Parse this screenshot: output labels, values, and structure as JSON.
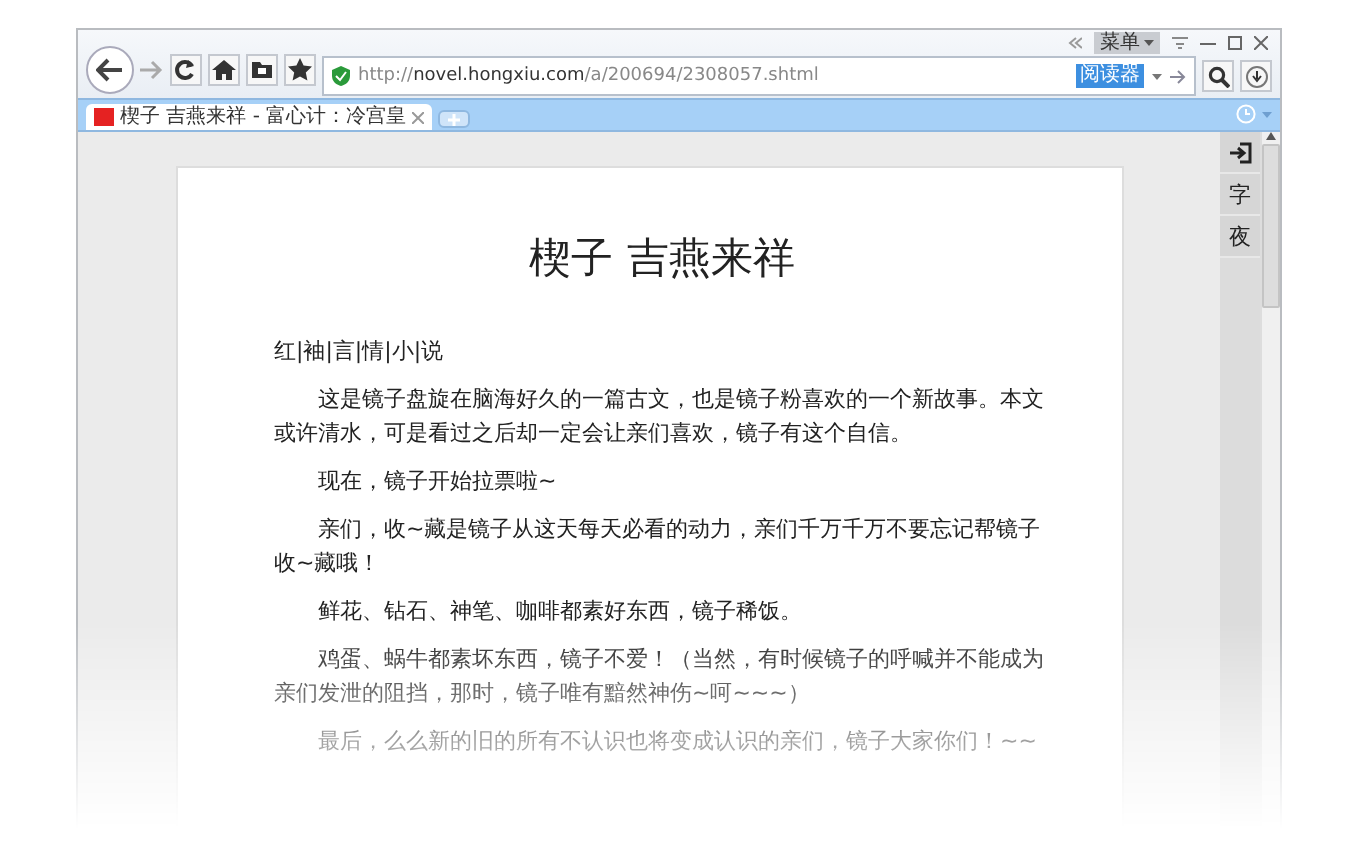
{
  "window_controls": {
    "menu_label": "菜单"
  },
  "toolbar": {
    "url": "http://**novel.hongxiu.com**/a/200694/2308057.shtml",
    "reader_label": "阅读器"
  },
  "tabs": [
    {
      "title": "楔子 吉燕来祥 - 富心计：冷宫皇",
      "selected": true
    }
  ],
  "side_tools": [
    {
      "kind": "icon"
    },
    {
      "kind": "text",
      "label": "字"
    },
    {
      "kind": "text",
      "label": "夜"
    }
  ],
  "article": {
    "title": "楔子 吉燕来祥",
    "category": "红|袖|言|情|小|说",
    "paragraphs": [
      "这是镜子盘旋在脑海好久的一篇古文，也是镜子粉喜欢的一个新故事。本文或许清水，可是看过之后却一定会让亲们喜欢，镜子有这个自信。",
      "现在，镜子开始拉票啦~",
      "亲们，收~藏是镜子从这天每天必看的动力，亲们千万千万不要忘记帮镜子收~藏哦！",
      "鲜花、钻石、神笔、咖啡都素好东西，镜子稀饭。",
      "鸡蛋、蜗牛都素坏东西，镜子不爱！（当然，有时候镜子的呼喊并不能成为亲们发泄的阻挡，那时，镜子唯有黯然神伤~呵~~~）",
      "最后，么么新的旧的所有不认识也将变成认识的亲们，镜子大家你们！~~"
    ]
  }
}
